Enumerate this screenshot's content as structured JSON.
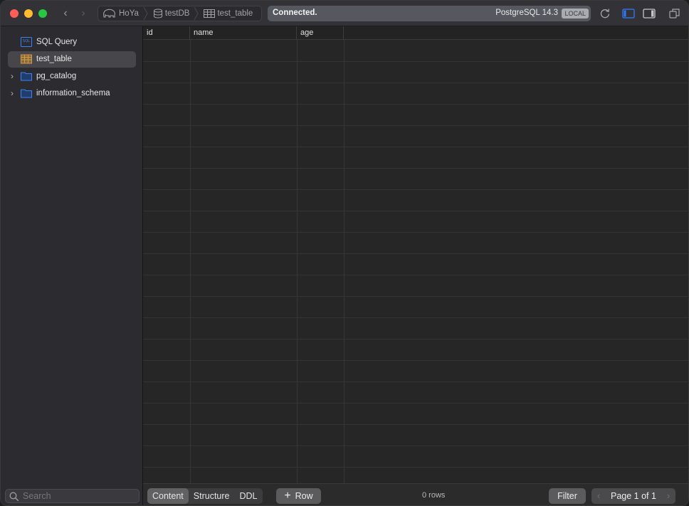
{
  "titlebar": {
    "breadcrumb": {
      "connection": "HoYa",
      "database": "testDB",
      "table": "test_table"
    },
    "status_text": "Connected.",
    "db_version": "PostgreSQL 14.3",
    "env_badge": "LOCAL"
  },
  "sidebar": {
    "items": [
      {
        "label": "SQL Query",
        "icon": "sql-file-icon",
        "expandable": false,
        "selected": false
      },
      {
        "label": "test_table",
        "icon": "table-icon",
        "expandable": false,
        "selected": true
      },
      {
        "label": "pg_catalog",
        "icon": "folder-icon",
        "expandable": true,
        "selected": false
      },
      {
        "label": "information_schema",
        "icon": "folder-icon",
        "expandable": true,
        "selected": false
      }
    ],
    "search_placeholder": "Search"
  },
  "grid": {
    "columns": [
      "id",
      "name",
      "age"
    ],
    "rows": []
  },
  "bottombar": {
    "tabs": [
      "Content",
      "Structure",
      "DDL"
    ],
    "active_tab": "Content",
    "add_row_label": "Row",
    "row_count": "0 rows",
    "filter_label": "Filter",
    "page_label": "Page 1 of 1"
  },
  "colors": {
    "accent": "#2f7bf5",
    "close": "#ff5f57",
    "minimize": "#febc2e",
    "maximize": "#28c840",
    "table_icon": "#d39a4a",
    "folder_icon": "#3b82f6"
  }
}
